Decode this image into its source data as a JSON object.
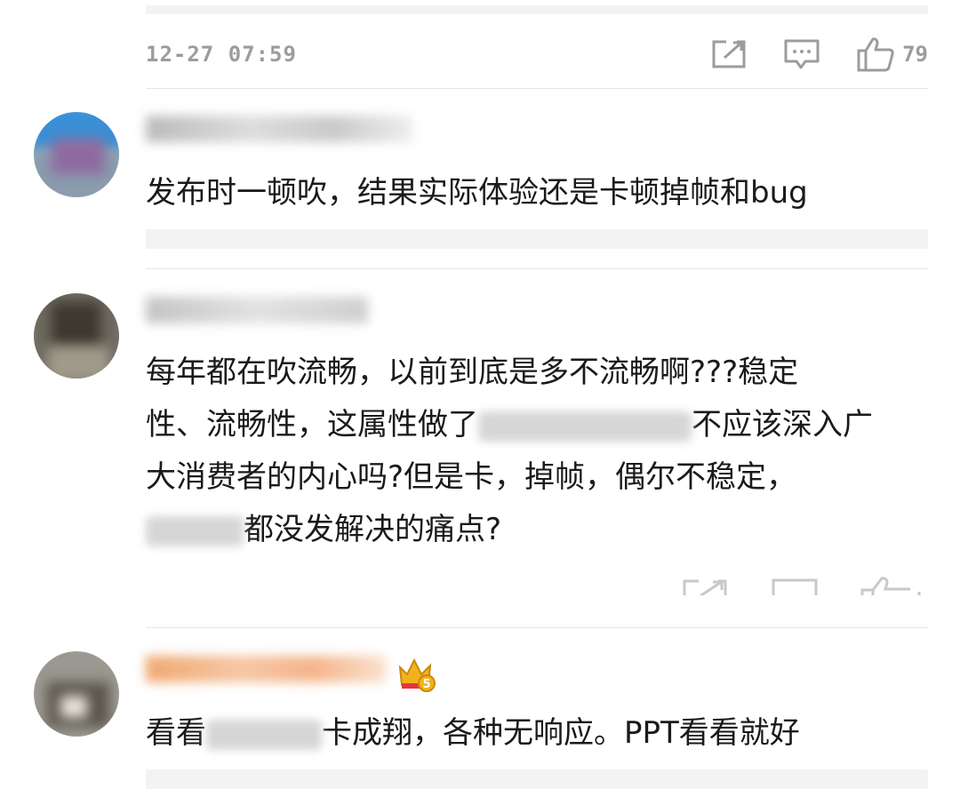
{
  "comments": [
    {
      "timestamp": "12-27 07:59",
      "like_count": "79",
      "icons": {
        "share": "share-icon",
        "reply": "comment-icon",
        "like": "thumbs-up-icon"
      }
    },
    {
      "username": "",
      "text": "发布时一顿吹，结果实际体验还是卡顿掉帧和bug"
    },
    {
      "username": "",
      "text_lines": [
        "每年都在吹流畅，以前到底是多不流畅啊???稳定",
        "性、流畅性，这属性做了",
        "不应该深入广",
        "大消费者的内心吗?但是卡，掉帧，偶尔不稳定，",
        "都没发解决的痛点?"
      ]
    },
    {
      "username": "",
      "badge": "crown-icon",
      "badge_level": "5",
      "text_parts": [
        "看看",
        "卡成翔，各种无响应。PPT看看就好"
      ]
    }
  ],
  "colors": {
    "meta_gray": "#9c9c9c",
    "text": "#1a1a1a",
    "strip_bg": "#f3f3f3",
    "divider": "#e6e6e6",
    "crown_gold": "#f2b21c",
    "crown_red": "#e8343a"
  }
}
